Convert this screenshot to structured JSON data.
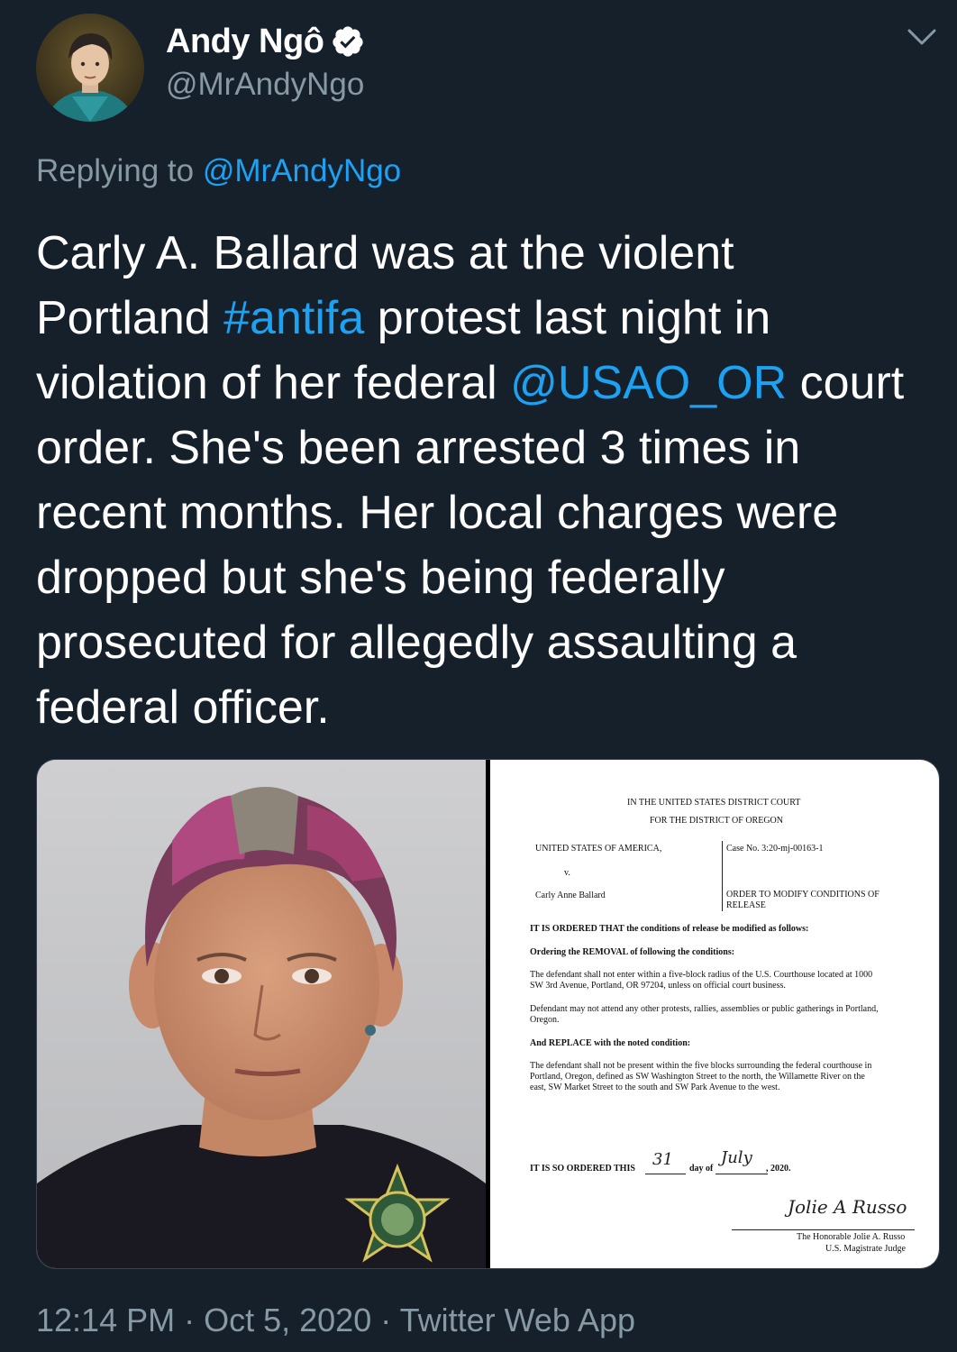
{
  "author": {
    "display_name": "Andy Ngô",
    "handle": "@MrAndyNgo"
  },
  "reply": {
    "prefix": "Replying to ",
    "mention": "@MrAndyNgo"
  },
  "tweet": {
    "lines": [
      [
        "Carly A. Ballard was at the violent"
      ],
      [
        "Portland ",
        "#antifa",
        " protest last night in"
      ],
      [
        "violation of her federal ",
        "@USAO_OR",
        " court"
      ],
      [
        "order. She's been arrested 3 times in"
      ],
      [
        "recent months. Her local charges were"
      ],
      [
        "dropped but she's being federally"
      ],
      [
        "prosecuted for allegedly assaulting a"
      ],
      [
        "federal officer."
      ]
    ],
    "links": [
      "#antifa",
      "@USAO_OR"
    ]
  },
  "document": {
    "court_line1": "IN THE UNITED STATES DISTRICT COURT",
    "court_line2": "FOR THE DISTRICT OF OREGON",
    "plaintiff": "UNITED STATES OF AMERICA,",
    "versus": "v.",
    "defendant": "Carly Anne Ballard",
    "case_no": "Case No. 3:20-mj-00163-1",
    "order_title_1": "ORDER TO MODIFY CONDITIONS OF",
    "order_title_2": "RELEASE",
    "ordered_line": "IT IS ORDERED THAT the conditions of release be modified as follows:",
    "removal_line": "Ordering the REMOVAL of following the conditions:",
    "cond1_l1": "The defendant shall not enter within a five-block radius of the U.S. Courthouse located at 1000",
    "cond1_l2": "SW 3rd Avenue, Portland, OR  97204, unless on official court business.",
    "cond2_l1": "Defendant may not attend any other protests, rallies, assemblies or public gatherings in Portland,",
    "cond2_l2": "Oregon.",
    "replace_line": "And REPLACE with the noted condition:",
    "cond3_l1": "The defendant shall not be present within the five blocks surrounding the federal courthouse in",
    "cond3_l2": "Portland, Oregon, defined as SW Washington Street to the north, the Willamette River on the",
    "cond3_l3": "east, SW Market Street to the south and SW Park Avenue to the west.",
    "so_ordered_prefix": "IT IS SO ORDERED THIS",
    "day_handwritten": "31",
    "day_of": "day of",
    "month_handwritten": "July",
    "year": ", 2020.",
    "signature": "Jolie A Russo",
    "judge_name": "The Honorable Jolie A. Russo",
    "judge_title": "U.S. Magistrate Judge"
  },
  "mugshot": {
    "badge_text_top": "MULTNOMAH COUNTY",
    "badge_text_bottom": "SHERIFF"
  },
  "footer": {
    "time": "12:14 PM",
    "date": "Oct 5, 2020",
    "source": "Twitter Web App",
    "separator": " · "
  },
  "colors": {
    "background": "#15202b",
    "text": "#ffffff",
    "muted": "#8899a6",
    "link": "#1da1f2",
    "border": "#38444d"
  },
  "icons": [
    "verified-badge-icon",
    "chevron-down-icon"
  ]
}
